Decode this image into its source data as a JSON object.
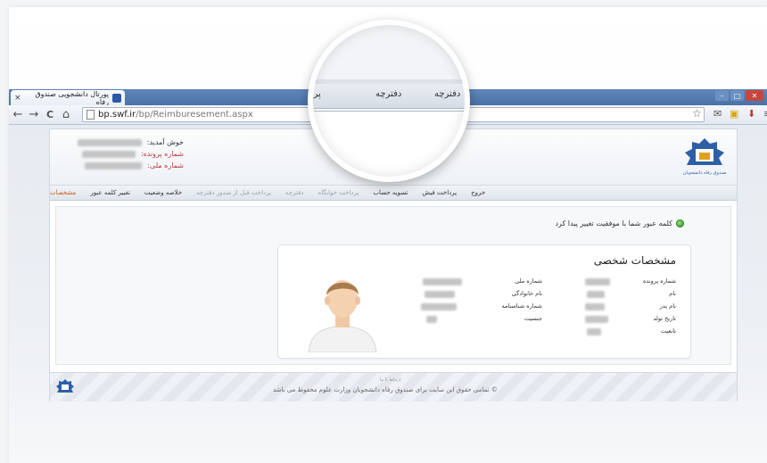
{
  "browser": {
    "tab_title": "پورتال دانشجویی صندوق رفاه",
    "tab_close": "×",
    "url_host": "bp.swf.ir",
    "url_path": "/bp/Reimburesement.aspx",
    "controls": {
      "minimize": "–",
      "maximize": "□",
      "close": "✕"
    },
    "nav": {
      "back": "←",
      "forward": "→",
      "reload": "C",
      "home": "⌂"
    },
    "star": "☆"
  },
  "header": {
    "welcome_label": "خوش آمدید:",
    "file_number_label": "شماره پرونده:",
    "national_id_label": "شماره ملی:",
    "logo_caption": "صندوق رفاه دانشجویان"
  },
  "menu": {
    "items": [
      {
        "label": "مشخصات",
        "state": "active"
      },
      {
        "label": "تغییر کلمه عبور",
        "state": "normal"
      },
      {
        "label": "خلاصه وضعیت",
        "state": "normal"
      },
      {
        "label": "پرداخت قبل از صدور دفترچه",
        "state": "dim"
      },
      {
        "label": "دفترچه",
        "state": "dim"
      },
      {
        "label": "پرداخت خوابگاه",
        "state": "dim"
      },
      {
        "label": "تسویه حساب",
        "state": "normal"
      },
      {
        "label": "پرداخت فیش",
        "state": "normal"
      },
      {
        "label": "خروج",
        "state": "normal"
      }
    ]
  },
  "message": {
    "text": "کلمه عبور شما با موفقیت تغییر پیدا کرد"
  },
  "profile": {
    "title": "مشخصات شخصی",
    "right_fields": [
      "شماره پرونده",
      "نام",
      "نام پدر",
      "تاریخ تولد",
      "تابعیت"
    ],
    "left_fields": [
      "شماره ملی",
      "نام خانوادگی",
      "شماره شناسنامه",
      "جنسیت"
    ]
  },
  "footer": {
    "version": "ارتباط با ما",
    "copyright": "© تمامی حقوق این سایت برای صندوق رفاه دانشجویان وزارت علوم محفوظ می باشد"
  },
  "magnifier": {
    "items": [
      "دفترچه",
      "دفترچه",
      "پرد"
    ]
  },
  "colors": {
    "accent": "#cc5a1a",
    "label_red": "#b53939",
    "tabstrip": "#4a72a8"
  }
}
